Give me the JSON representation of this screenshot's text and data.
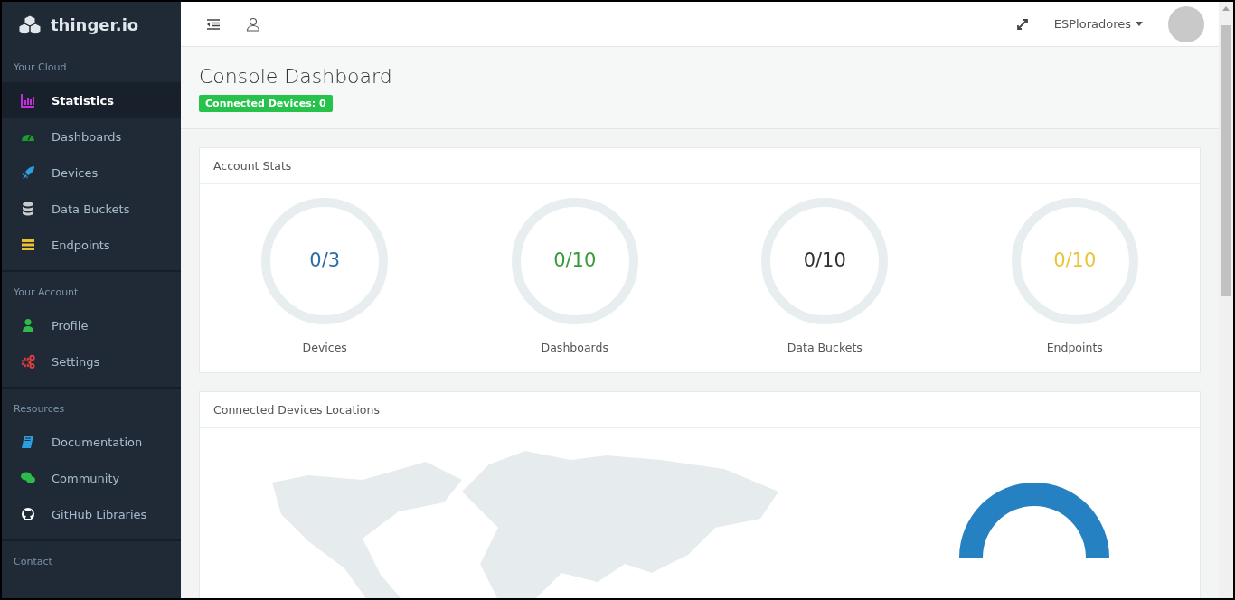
{
  "sidebar": {
    "brand": "thinger.io",
    "sections": [
      {
        "title": "Your Cloud",
        "items": [
          {
            "label": "Statistics",
            "selected": true
          },
          {
            "label": "Dashboards",
            "selected": false
          },
          {
            "label": "Devices",
            "selected": false
          },
          {
            "label": "Data Buckets",
            "selected": false
          },
          {
            "label": "Endpoints",
            "selected": false
          }
        ]
      },
      {
        "title": "Your Account",
        "items": [
          {
            "label": "Profile",
            "selected": false
          },
          {
            "label": "Settings",
            "selected": false
          }
        ]
      },
      {
        "title": "Resources",
        "items": [
          {
            "label": "Documentation",
            "selected": false
          },
          {
            "label": "Community",
            "selected": false
          },
          {
            "label": "GitHub Libraries",
            "selected": false
          }
        ]
      },
      {
        "title": "Contact"
      }
    ]
  },
  "topbar": {
    "user": "ESPloradores"
  },
  "page": {
    "title": "Console Dashboard",
    "badge": "Connected Devices: 0"
  },
  "account_stats": {
    "title": "Account Stats",
    "stats": [
      {
        "value": "0/3",
        "label": "Devices",
        "color": "#2c6ea8"
      },
      {
        "value": "0/10",
        "label": "Dashboards",
        "color": "#3a9a3a"
      },
      {
        "value": "0/10",
        "label": "Data Buckets",
        "color": "#333333"
      },
      {
        "value": "0/10",
        "label": "Endpoints",
        "color": "#e8c63a"
      }
    ]
  },
  "locations": {
    "title": "Connected Devices Locations"
  }
}
